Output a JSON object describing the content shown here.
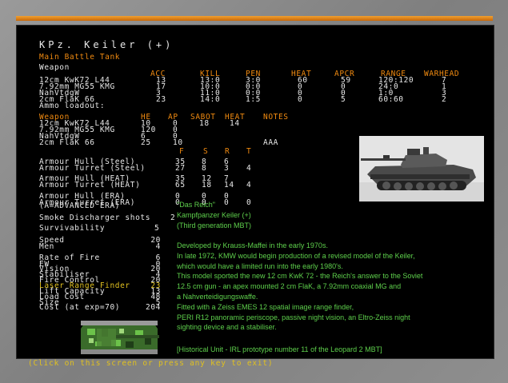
{
  "unit": {
    "name": "KPz. Keiler (+)",
    "role": "Main Battle Tank"
  },
  "weapons": {
    "section_label": "Weapon",
    "headers": [
      "ACC",
      "KILL",
      "PEN",
      "HEAT",
      "APCR",
      "RANGE",
      "WARHEAD"
    ],
    "rows": [
      {
        "name": "12cm KwK72 L44",
        "acc": "13",
        "kill": "13:0",
        "pen": "3:0",
        "heat": "60",
        "apcr": "59",
        "range": "120:120",
        "warhead": "7"
      },
      {
        "name": "7.92mm MG55 KMG",
        "acc": "17",
        "kill": "10:0",
        "pen": "0:0",
        "heat": "0",
        "apcr": "0",
        "range": "24:0",
        "warhead": "1"
      },
      {
        "name": "NahVtdgW",
        "acc": "3",
        "kill": "11:0",
        "pen": "0:0",
        "heat": "0",
        "apcr": "0",
        "range": "1:0",
        "warhead": "3"
      },
      {
        "name": "2cm FlaK 66",
        "acc": "23",
        "kill": "14:0",
        "pen": "1:5",
        "heat": "0",
        "apcr": "5",
        "range": "60:60",
        "warhead": "2"
      }
    ]
  },
  "ammo": {
    "section_label": "Ammo loadout:",
    "headers": [
      "Weapon",
      "HE",
      "AP",
      "SABOT",
      "HEAT",
      "NOTES"
    ],
    "rows": [
      {
        "name": "12cm KwK72 L44",
        "he": "10",
        "ap": "0",
        "sabot": "18",
        "heat": "14",
        "notes": ""
      },
      {
        "name": "7.92mm MG55 KMG",
        "he": "120",
        "ap": "0",
        "sabot": "",
        "heat": "",
        "notes": ""
      },
      {
        "name": "NahVtdgW",
        "he": "6",
        "ap": "0",
        "sabot": "",
        "heat": "",
        "notes": ""
      },
      {
        "name": "2cm FlaK 66",
        "he": "25",
        "ap": "10",
        "sabot": "",
        "heat": "",
        "notes": "AAA"
      }
    ]
  },
  "armour": {
    "headers": [
      "F",
      "S",
      "R",
      "T"
    ],
    "rows": [
      {
        "label": "Armour Hull (Steel)",
        "f": "35",
        "s": "8",
        "r": "6",
        "t": ""
      },
      {
        "label": "Armour Turret (Steel)",
        "f": "27",
        "s": "8",
        "r": "3",
        "t": "4"
      },
      {
        "label": "Armour Hull (HEAT)",
        "f": "35",
        "s": "12",
        "r": "7",
        "t": ""
      },
      {
        "label": "Armour Turret (HEAT)",
        "f": "65",
        "s": "18",
        "r": "14",
        "t": "4"
      },
      {
        "label": "Armour Hull (ERA)",
        "f": "0",
        "s": "0",
        "r": "0",
        "t": ""
      },
      {
        "label": "Armour Turret (ERA)",
        "f": "0",
        "s": "0",
        "r": "0",
        "t": "0"
      }
    ],
    "note": "(A=ADVANCED ERA)"
  },
  "stats": {
    "smoke": {
      "label": "Smoke Discharger shots",
      "value": "2"
    },
    "survivability": {
      "label": "Survivability",
      "value": "5"
    },
    "rows": [
      {
        "label": "Speed",
        "value": "20",
        "highlight": false
      },
      {
        "label": "Men",
        "value": "4",
        "highlight": false
      },
      {
        "label": "Rate of Fire",
        "value": "6",
        "highlight": false
      },
      {
        "label": "EW",
        "value": "0",
        "highlight": false
      },
      {
        "label": "Vision",
        "value": "20",
        "highlight": false
      },
      {
        "label": "Stabiliser",
        "value": "4",
        "highlight": false
      },
      {
        "label": "Fire Control",
        "value": "20",
        "highlight": false
      },
      {
        "label": "Laser Range Finder",
        "value": "23",
        "highlight": true
      },
      {
        "label": "Lift Capacity",
        "value": "13",
        "highlight": false
      },
      {
        "label": "Load Cost",
        "value": "48",
        "highlight": false
      },
      {
        "label": "Size",
        "value": "5",
        "highlight": false
      },
      {
        "label": "Cost (at exp=70)",
        "value": "204",
        "highlight": false
      }
    ]
  },
  "description": {
    "unit_label": "\"Das Reich\"",
    "name": "Kampfpanzer Keiler (+)",
    "generation": "(Third generation MBT)",
    "lines": [
      "Developed by Krauss-Maffei in the early 1970s.",
      "In late 1972, KMW would begin production of a revised model of the Keiler,",
      "which would have a limited run into the early 1980's.",
      "This model sported the new 12 cm KwK 72 - the Reich's answer to the Soviet",
      "12.5 cm gun - an apex mounted 2 cm FlaK, a 7.92mm coaxial MG and",
      "a Nahverteidigungswaffe.",
      "Fitted with a Zeiss EMES 12 spatial image range finder,",
      "PERI R12 panoramic periscope, passive night vision, an Eltro-Zeiss night",
      "sighting device and a stabiliser."
    ],
    "historical": "[Historical Unit - IRL prototype number 11 of the Leopard 2 MBT]"
  },
  "footer": "(Click on this screen or press any key to exit)",
  "colors": {
    "orange": "#f08a10",
    "yellow": "#e0c020",
    "green": "#5ed04c",
    "text": "#e8e8e8",
    "screen_bg": "#000000"
  }
}
